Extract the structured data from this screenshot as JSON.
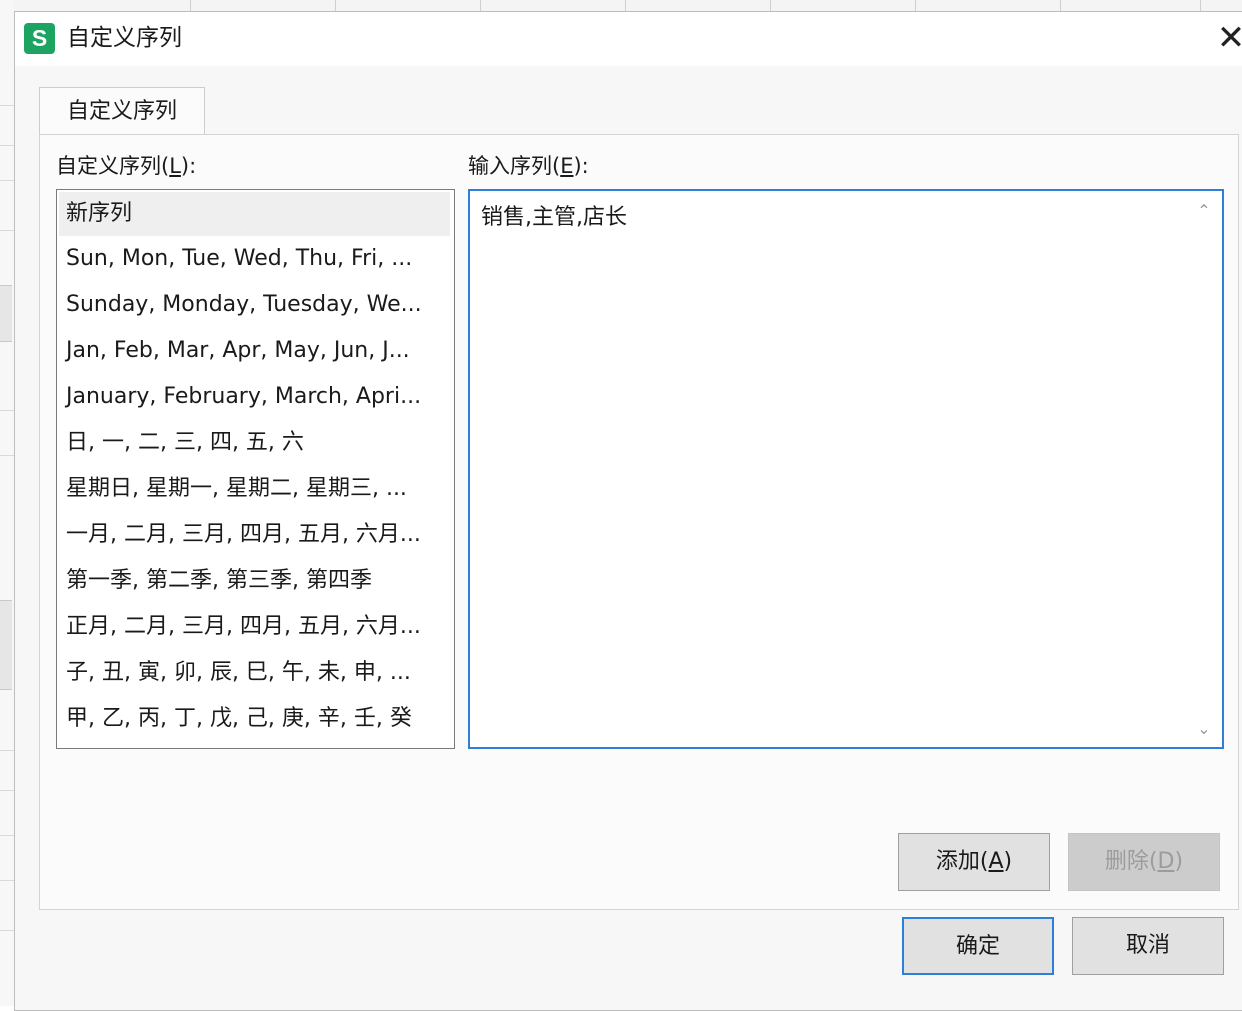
{
  "window": {
    "title": "自定义序列",
    "app_icon_letter": "S",
    "close_glyph": "✕"
  },
  "tabs": [
    {
      "label": "自定义序列"
    }
  ],
  "list_section": {
    "label": "自定义序列(",
    "mnemonic": "L",
    "label_suffix": "):",
    "items": [
      "新序列",
      "Sun, Mon, Tue, Wed, Thu, Fri, ...",
      "Sunday, Monday, Tuesday, We...",
      "Jan, Feb, Mar, Apr, May, Jun, J...",
      "January, February, March, Apri...",
      "日, 一, 二, 三, 四, 五, 六",
      "星期日, 星期一, 星期二, 星期三, ...",
      "一月, 二月, 三月, 四月, 五月, 六月...",
      "第一季, 第二季, 第三季, 第四季",
      "正月, 二月, 三月, 四月, 五月, 六月...",
      "子, 丑, 寅, 卯, 辰, 巳, 午, 未, 申, ...",
      "甲, 乙, 丙, 丁, 戊, 己, 庚, 辛, 壬, 癸"
    ],
    "selected_index": 0
  },
  "input_section": {
    "label": "输入序列(",
    "mnemonic": "E",
    "label_suffix": "):",
    "value": "销售,主管,店长"
  },
  "buttons": {
    "add": {
      "label": "添加(",
      "mnemonic": "A",
      "suffix": ")"
    },
    "delete": {
      "label": "删除(",
      "mnemonic": "D",
      "suffix": ")",
      "enabled": false
    },
    "ok": {
      "label": "确定"
    },
    "cancel": {
      "label": "取消"
    }
  },
  "colors": {
    "accent": "#2f7ed8",
    "app_icon": "#1da462"
  }
}
